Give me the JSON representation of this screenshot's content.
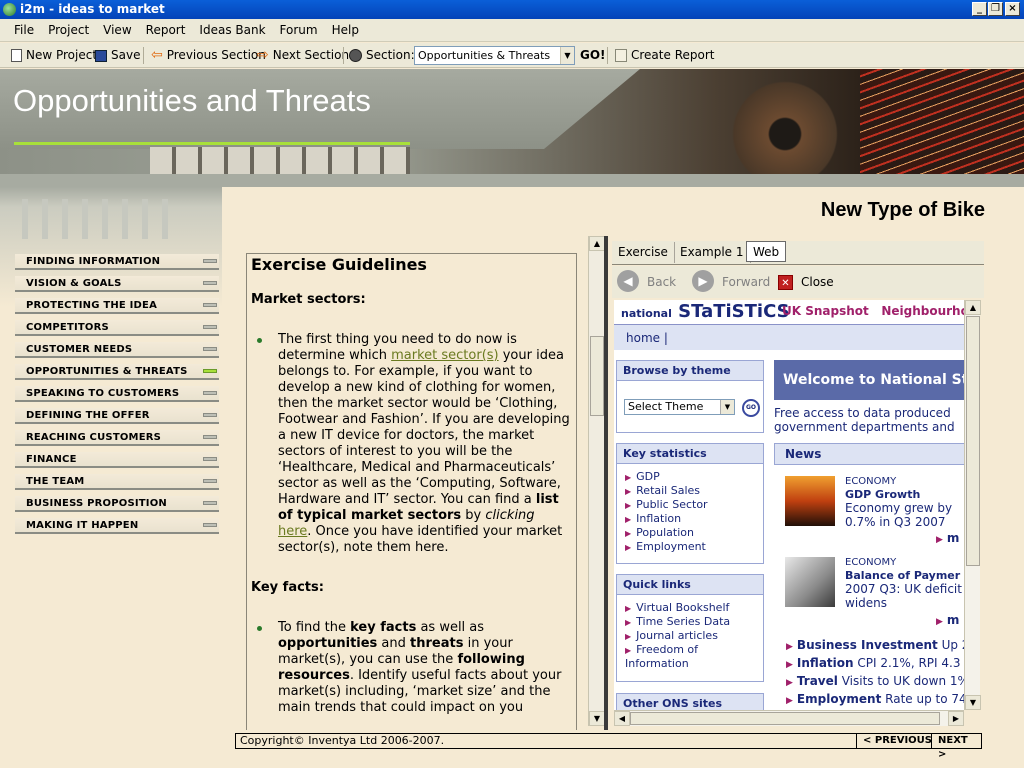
{
  "window": {
    "title": "i2m - ideas to market"
  },
  "menu": [
    "File",
    "Project",
    "View",
    "Report",
    "Ideas Bank",
    "Forum",
    "Help"
  ],
  "toolbar": {
    "new_project": "New Project",
    "save": "Save",
    "previous_section": "Previous Section",
    "next_section": "Next Section",
    "section_label": "Section:",
    "section_value": "Opportunities & Threats",
    "go": "GO!",
    "create_report": "Create Report"
  },
  "banner": {
    "title": "Opportunities and Threats"
  },
  "project_title": "New Type of Bike",
  "nav": {
    "items": [
      "FINDING INFORMATION",
      "VISION & GOALS",
      "PROTECTING THE IDEA",
      "COMPETITORS",
      "CUSTOMER NEEDS",
      "OPPORTUNITIES & THREATS",
      "SPEAKING TO CUSTOMERS",
      "DEFINING THE OFFER",
      "REACHING CUSTOMERS",
      "FINANCE",
      "THE TEAM",
      "BUSINESS PROPOSITION",
      "MAKING IT HAPPEN"
    ],
    "active": "OPPORTUNITIES & THREATS"
  },
  "guide": {
    "title": "Exercise Guidelines",
    "h_market": "Market sectors:",
    "p1_a": "The first thing you need to do now is determine which ",
    "p1_link": "market sector(s)",
    "p1_b": " your idea belongs to. For example, if you want to develop a new kind of clothing for women, then the market sector would be ‘Clothing, Footwear and Fashion’. If you are developing a new IT device for doctors, the market sectors of interest to you will be the ‘Healthcare, Medical and Pharmaceuticals’ sector as well as the ‘Computing, Software, Hardware and IT’ sector. You can find a ",
    "p1_bold": "list of typical market sectors",
    "p1_c": " by ",
    "p1_italic": "clicking",
    "p1_d": " ",
    "p1_link2": "here",
    "p1_e": ". Once you have identified your market sector(s), note them here.",
    "h_keyfacts": "Key facts:",
    "p2_a": "To find the ",
    "p2_b1": "key facts",
    "p2_c": " as well as ",
    "p2_b2": "opportunities",
    "p2_d": " and ",
    "p2_b3": "threats",
    "p2_e": " in your market(s), you can use the ",
    "p2_b4": "following resources",
    "p2_f": ". Identify useful facts about your market(s) including, ‘market size’ and the main trends that could impact on you"
  },
  "tabs": [
    "Exercise",
    "Example 1",
    "Web"
  ],
  "active_tab": "Web",
  "browser": {
    "back": "Back",
    "forward": "Forward",
    "close": "Close"
  },
  "web": {
    "logo_small": "national",
    "logo_big": "STaTiSTiCS",
    "snapshot": "UK Snapshot",
    "neighbourhood": "Neighbourhood",
    "home": "home |",
    "browse_theme": "Browse by theme",
    "select_theme": "Select Theme",
    "go": "GO",
    "key_statistics": "Key statistics",
    "key_items": [
      "GDP",
      "Retail Sales",
      "Public Sector",
      "Inflation",
      "Population",
      "Employment"
    ],
    "quick_links": "Quick links",
    "quick_items": [
      "Virtual Bookshelf",
      "Time Series Data",
      "Journal articles",
      "Freedom of Information"
    ],
    "other_sites": "Other ONS sites",
    "welcome": "Welcome to National St",
    "free_access_1": "Free access to data produced",
    "free_access_2": "government departments and",
    "news": "News",
    "news1_cat": "ECONOMY",
    "news1_title": "GDP Growth",
    "news1_body_1": "Economy grew by",
    "news1_body_2": "0.7% in Q3 2007",
    "news2_cat": "ECONOMY",
    "news2_title": "Balance of Paymer",
    "news2_body_1": "2007 Q3: UK deficit",
    "news2_body_2": "widens",
    "more": "m",
    "headlines": [
      {
        "b": "Business Investment",
        "t": " Up 2"
      },
      {
        "b": "Inflation",
        "t": " CPI 2.1%, RPI 4.3"
      },
      {
        "b": "Travel",
        "t": " Visits to UK down 1%"
      },
      {
        "b": "Employment",
        "t": " Rate up to 74."
      }
    ]
  },
  "footer": {
    "copyright": "Copyright© Inventya Ltd 2006-2007.",
    "previous": "< PREVIOUS",
    "next": "NEXT >"
  }
}
